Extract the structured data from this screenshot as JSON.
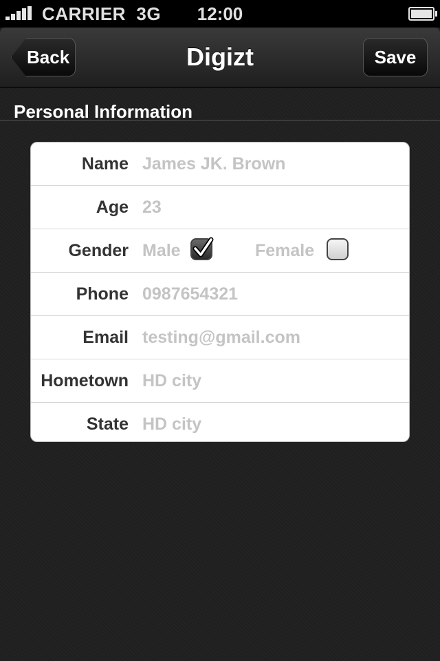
{
  "status_bar": {
    "carrier": "CARRIER",
    "network": "3G",
    "time": "12:00",
    "signal_icon": "signal-bars-icon",
    "battery_icon": "battery-full-icon"
  },
  "nav": {
    "back_label": "Back",
    "title": "Digizt",
    "save_label": "Save"
  },
  "section": {
    "title": "Personal Information"
  },
  "form": {
    "name": {
      "label": "Name",
      "value": "James JK. Brown"
    },
    "age": {
      "label": "Age",
      "value": "23"
    },
    "gender": {
      "label": "Gender",
      "options": [
        {
          "label": "Male",
          "checked": true
        },
        {
          "label": "Female",
          "checked": false
        }
      ]
    },
    "phone": {
      "label": "Phone",
      "value": "0987654321"
    },
    "email": {
      "label": "Email",
      "value": "testing@gmail.com"
    },
    "hometown": {
      "label": "Hometown",
      "value": "HD city"
    },
    "state": {
      "label": "State",
      "value": "HD city"
    }
  },
  "colors": {
    "text_label": "#333333",
    "text_value": "#c4c4c4",
    "background": "#202020"
  }
}
